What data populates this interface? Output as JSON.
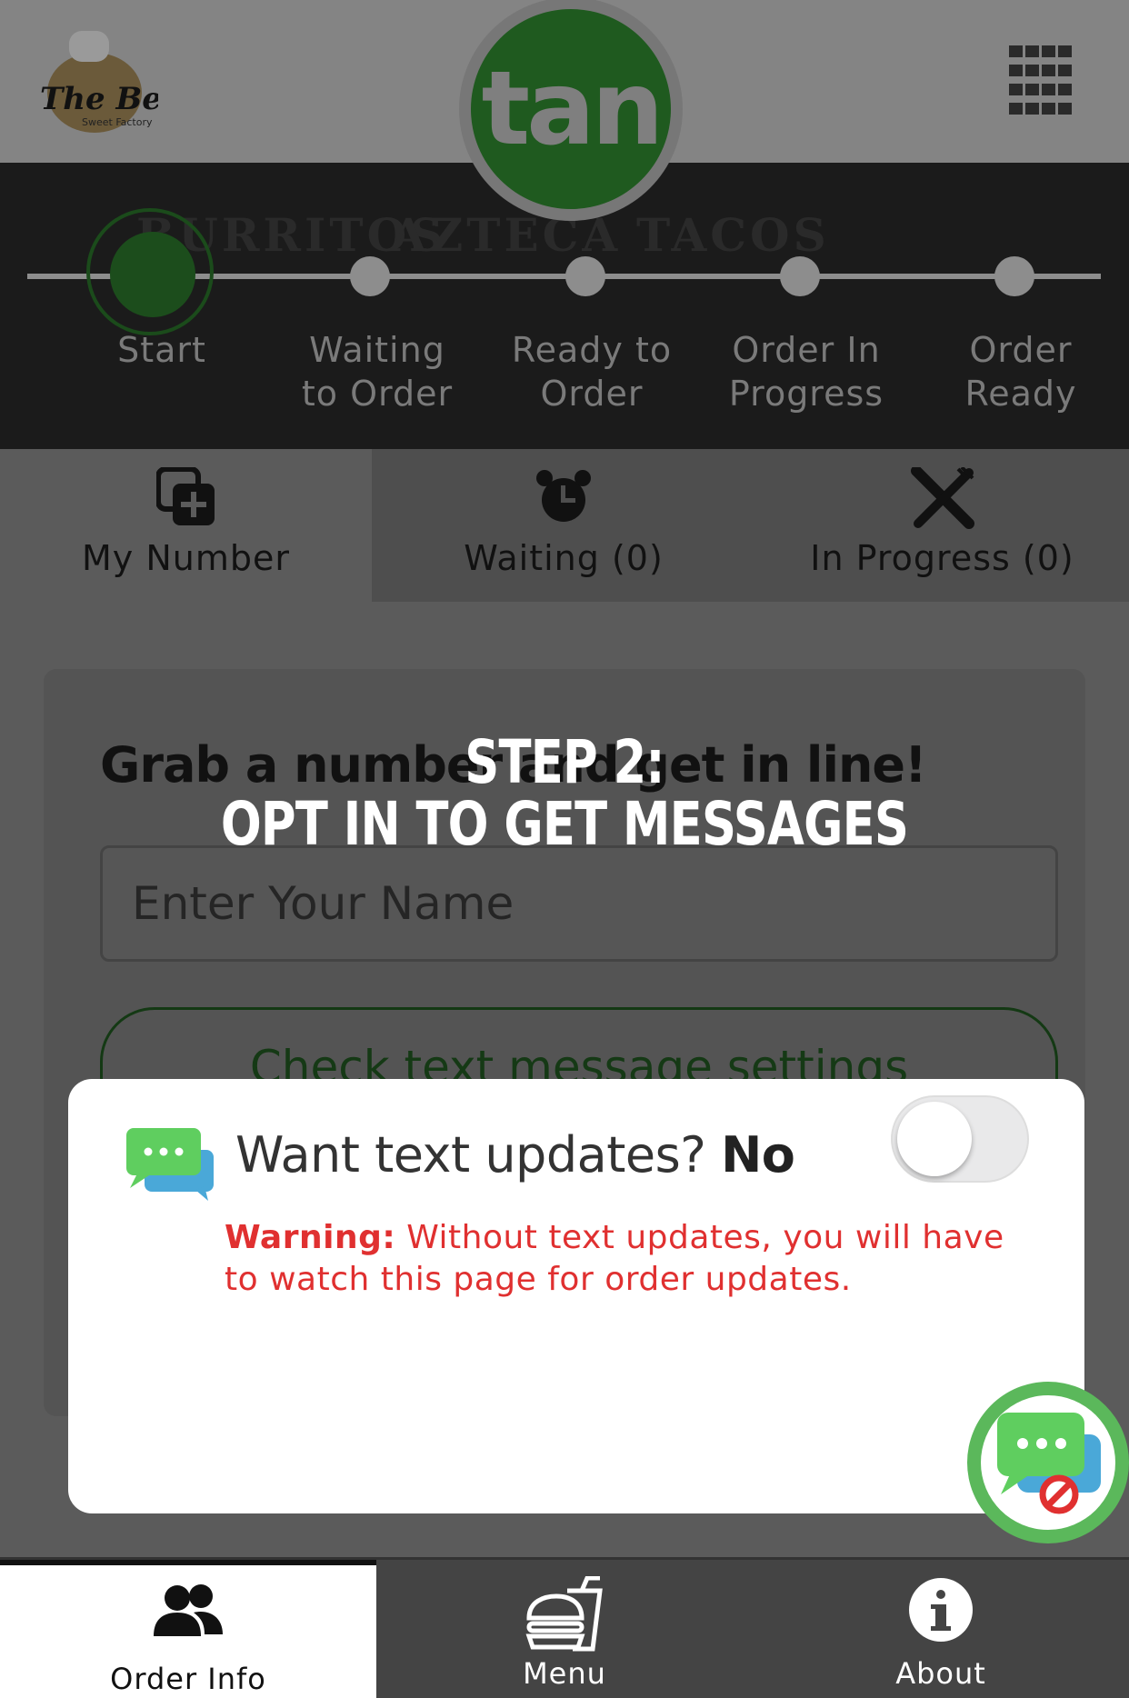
{
  "header": {
    "brand_logo_icon": "the-bells-sweet-factory-logo",
    "brand_logo_text": "The Bells",
    "brand_logo_subtext": "Sweet Factory",
    "app_logo_text": "tan",
    "menu_icon": "grid-icon"
  },
  "hero": {
    "sign_words": [
      "BURRITOS",
      "AZTECA",
      "TACOS"
    ],
    "steps": [
      "Start",
      "Waiting to Order",
      "Ready to Order",
      "Order In Progress",
      "Order Ready"
    ],
    "steps_lines": [
      [
        "Start"
      ],
      [
        "Waiting",
        "to Order"
      ],
      [
        "Ready to",
        "Order"
      ],
      [
        "Order In",
        "Progress"
      ],
      [
        "Order",
        "Ready"
      ]
    ],
    "active_step": "Start"
  },
  "tabs": [
    {
      "label": "My Number",
      "icon": "add-copy-icon",
      "active": true
    },
    {
      "label": "Waiting (0)",
      "icon": "alarm-clock-icon",
      "active": false
    },
    {
      "label": "In Progress (0)",
      "icon": "fork-knife-icon",
      "active": false
    }
  ],
  "card": {
    "heading": "Grab a number and get in line!",
    "name_placeholder": "Enter Your Name",
    "sms_settings_label": "Check text message settings"
  },
  "overlay": {
    "line1": "STEP 2:",
    "line2": "OPT IN TO GET MESSAGES"
  },
  "modal": {
    "chat_icon": "chat-bubbles-icon",
    "question": "Want text updates?",
    "answer": "No",
    "toggle_on": false,
    "warning_label": "Warning:",
    "warning_text": "Without text updates, you will have to watch this page for order updates."
  },
  "fab": {
    "icon": "chat-disabled-icon"
  },
  "bottom_nav": [
    {
      "label": "Order Info",
      "icon": "users-icon",
      "active": true
    },
    {
      "label": "Menu",
      "icon": "burger-drink-icon",
      "active": false
    },
    {
      "label": "About",
      "icon": "info-icon",
      "active": false
    }
  ],
  "colors": {
    "brand_green": "#2e8b2e",
    "warning_red": "#e03030",
    "fab_ring": "#5bb85b"
  }
}
